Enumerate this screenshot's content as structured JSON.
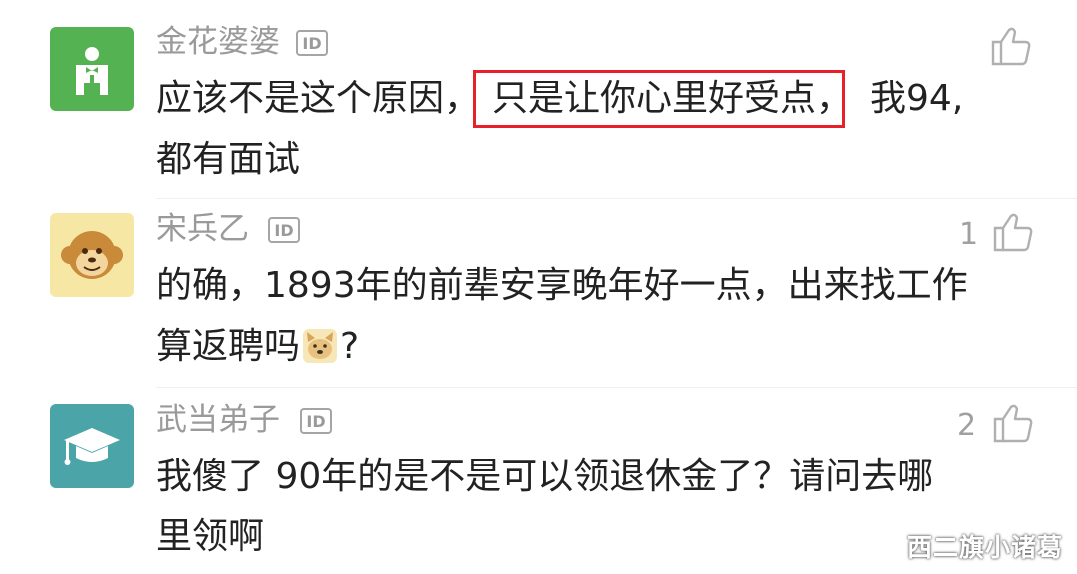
{
  "comments": [
    {
      "username": "金花婆婆",
      "badge": "ID",
      "line1_a": "应该不是这个原因，",
      "line1_b": "只是让你心里好受点，",
      "line1_c": "我94,",
      "line2": "都有面试",
      "likes": "",
      "avatar": "waiter-icon",
      "avatar_color": "#55b253"
    },
    {
      "username": "宋兵乙",
      "badge": "ID",
      "line1": "的确，1893年的前辈安享晚年好一点，出来找工作",
      "line2_a": "算返聘吗",
      "line2_b": "?",
      "likes": "1",
      "avatar": "monkey-icon",
      "avatar_color": "#f6e7a4"
    },
    {
      "username": "武当弟子",
      "badge": "ID",
      "line1": "我傻了 90年的是不是可以领退休金了？请问去哪",
      "line2": "里领啊",
      "likes": "2",
      "avatar": "graduation-cap-icon",
      "avatar_color": "#4aa4a8"
    }
  ],
  "watermark": "西二旗小诸葛",
  "icons": {
    "like": "thumbs-up-icon",
    "emoji": "doge-emoji-icon"
  }
}
